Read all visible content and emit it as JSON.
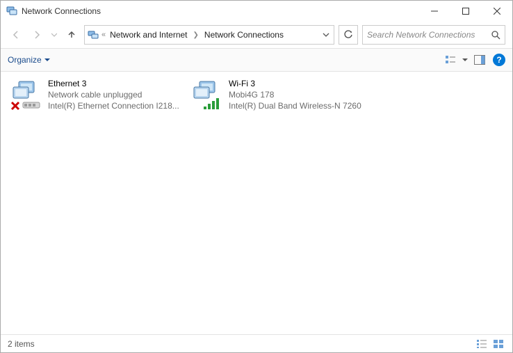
{
  "window": {
    "title": "Network Connections"
  },
  "address": {
    "overflow": "«",
    "segments": [
      "Network and Internet",
      "Network Connections"
    ]
  },
  "search": {
    "placeholder": "Search Network Connections"
  },
  "commandbar": {
    "organize": "Organize"
  },
  "connections": [
    {
      "name": "Ethernet 3",
      "status": "Network cable unplugged",
      "device": "Intel(R) Ethernet Connection I218...",
      "type": "ethernet",
      "error": true
    },
    {
      "name": "Wi-Fi 3",
      "status": "Mobi4G 178",
      "device": "Intel(R) Dual Band Wireless-N 7260",
      "type": "wifi",
      "error": false
    }
  ],
  "statusbar": {
    "text": "2 items"
  }
}
